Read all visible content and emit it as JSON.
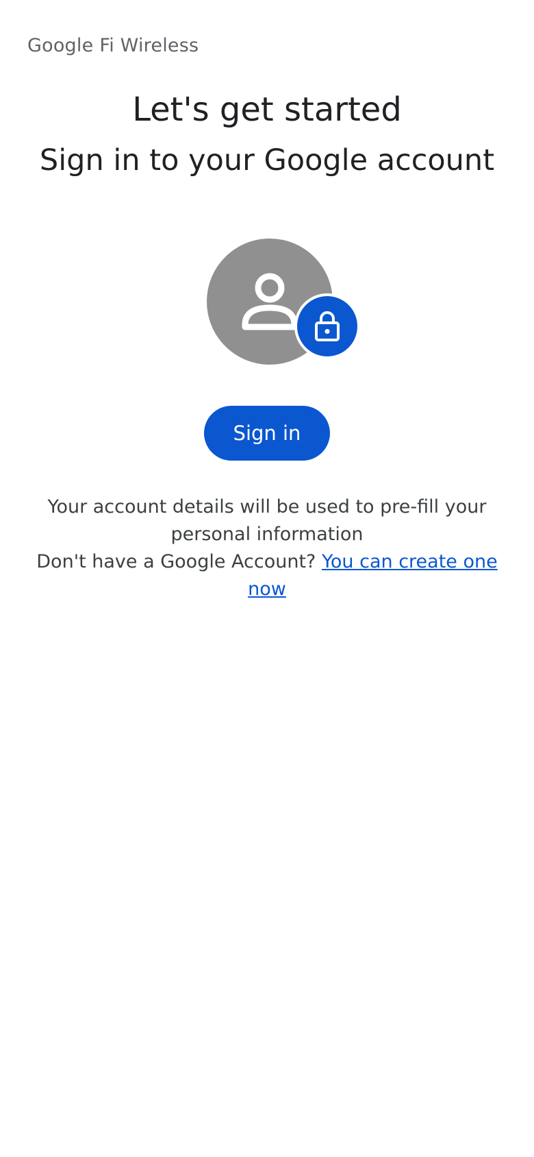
{
  "header": {
    "brand_google": "Google",
    "brand_product": "Fi Wireless"
  },
  "main": {
    "title": "Let's get started",
    "subtitle": "Sign in to your Google account",
    "illustration": {
      "avatar_icon": "person-icon",
      "badge_icon": "lock-icon",
      "avatar_color": "#909090",
      "badge_color": "#0b57d0"
    },
    "signin_label": "Sign in",
    "description_line1": "Your account details will be used to pre-fill your personal information",
    "no_account_text": "Don't have a Google Account?",
    "create_link_text": "You can create one now"
  },
  "colors": {
    "accent": "#0b57d0",
    "text_primary": "#202124",
    "text_secondary": "#3c4043"
  }
}
